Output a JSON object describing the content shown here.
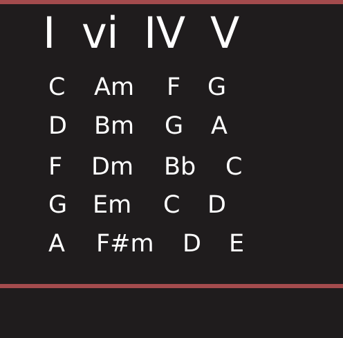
{
  "heading": [
    "I",
    "vi",
    "IV",
    "V"
  ],
  "rows": [
    [
      "C",
      "Am",
      "F",
      "G"
    ],
    [
      "D",
      "Bm",
      "G",
      "A"
    ],
    [
      "F",
      "Dm",
      "Bb",
      "C"
    ],
    [
      "G",
      "Em",
      "C",
      "D"
    ],
    [
      "A",
      "F#m",
      "D",
      "E"
    ]
  ],
  "colors": {
    "background": "#1f1c1d",
    "accent": "#a34b4d",
    "text": "#ffffff"
  }
}
